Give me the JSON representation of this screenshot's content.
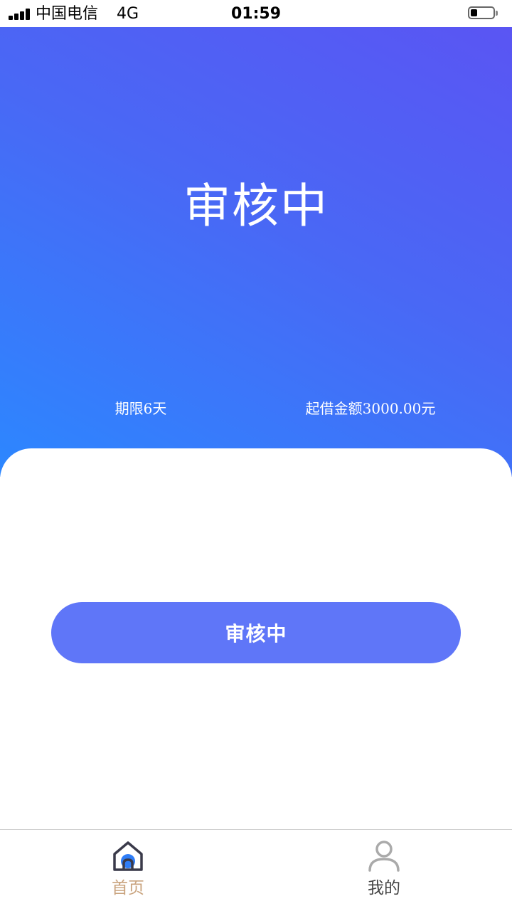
{
  "status_bar": {
    "carrier": "中国电信",
    "network": "4G",
    "time": "01:59",
    "battery_level": 0.3,
    "icons": [
      "signal-bars-icon",
      "battery-icon"
    ]
  },
  "hero": {
    "title": "审核中",
    "term": "期限6天",
    "amount": "起借金额3000.00元",
    "gradient_colors": [
      "#2c87ff",
      "#4968f5",
      "#5a55f3"
    ]
  },
  "main": {
    "review_button_label": "审核中",
    "button_color": "#5f76f8"
  },
  "tab_bar": {
    "items": [
      {
        "label": "首页",
        "icon": "home-icon",
        "active": true,
        "color": "#c9a37e"
      },
      {
        "label": "我的",
        "icon": "user-icon",
        "active": false,
        "color": "#444444"
      }
    ]
  }
}
